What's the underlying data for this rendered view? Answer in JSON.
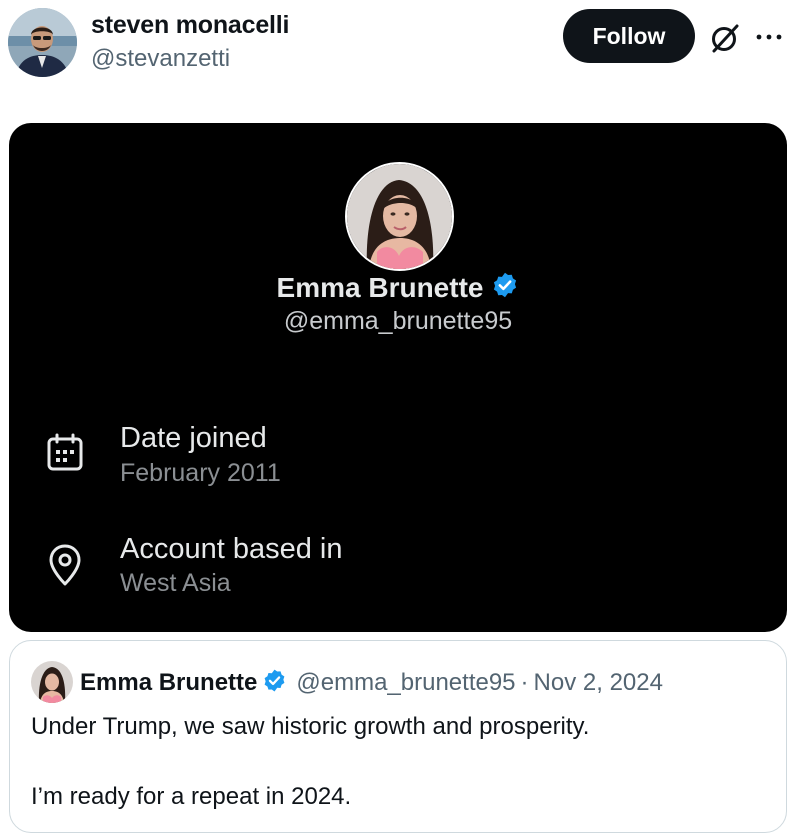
{
  "author": {
    "name": "steven monacelli",
    "handle": "@stevanzetti",
    "follow_label": "Follow"
  },
  "icons": {
    "grok": "grok-icon",
    "more": "more-icon",
    "verified": "verified-badge-icon",
    "calendar": "calendar-icon",
    "location": "location-pin-icon"
  },
  "colors": {
    "verified": "#1d9bf0",
    "follow_button": "#0f1419",
    "media_background": "#000000"
  },
  "media": {
    "profile_name": "Emma Brunette",
    "profile_handle": "@emma_brunette95",
    "date_joined_label": "Date joined",
    "date_joined_value": "February 2011",
    "location_label": "Account based in",
    "location_value": "West Asia"
  },
  "quote": {
    "name": "Emma Brunette",
    "handle": "@emma_brunette95",
    "separator": "·",
    "date": "Nov 2, 2024",
    "line1": "Under Trump, we saw historic growth and prosperity.",
    "line2": "I’m ready for a repeat in 2024."
  }
}
